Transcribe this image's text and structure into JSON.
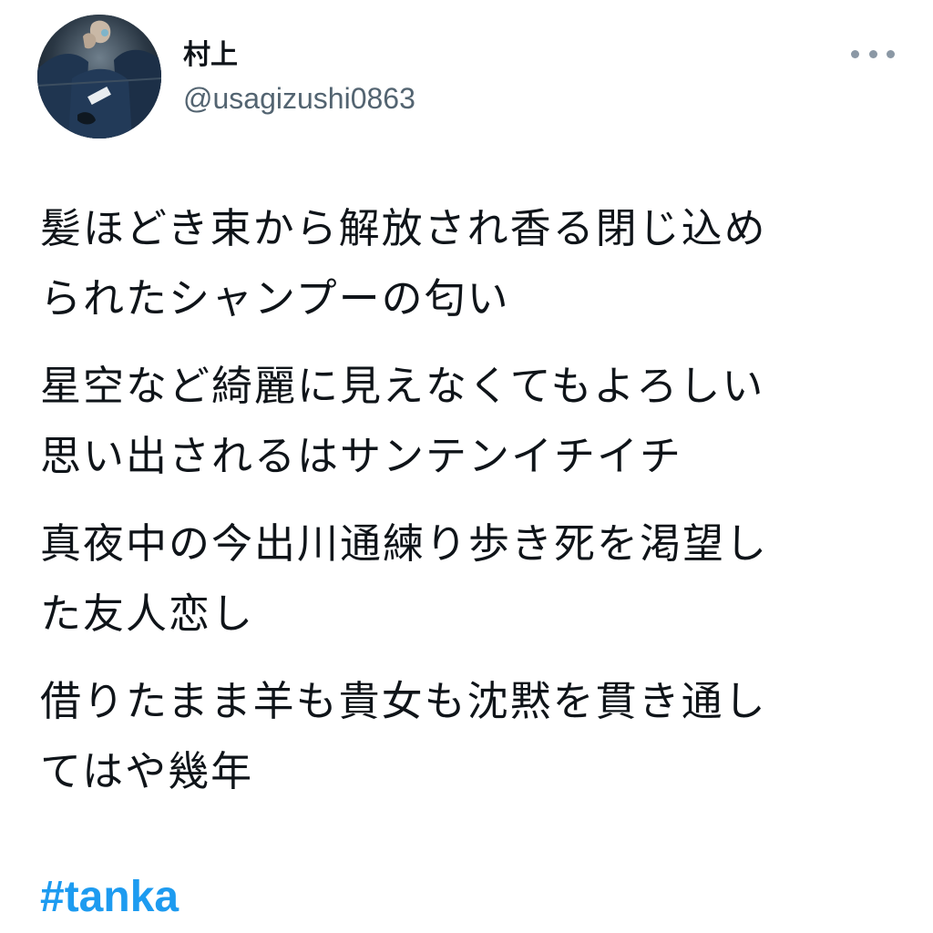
{
  "author": {
    "display_name": "村上",
    "handle": "@usagizushi0863",
    "avatar_icon": "profile-photo"
  },
  "menu": {
    "icon": "more-horizontal-icon"
  },
  "tweet": {
    "stanzas": [
      {
        "lines": [
          "髪ほどき束から解放され香る閉じ込め",
          "られたシャンプーの匂い"
        ]
      },
      {
        "lines": [
          "星空など綺麗に見えなくてもよろしい",
          "思い出されるはサンテンイチイチ"
        ]
      },
      {
        "lines": [
          "真夜中の今出川通練り歩き死を渇望し",
          "た友人恋し"
        ]
      },
      {
        "lines": [
          "借りたまま羊も貴女も沈黙を貫き通し",
          "てはや幾年"
        ]
      }
    ],
    "hashtag": "#tanka"
  },
  "colors": {
    "text": "#0f1419",
    "secondary": "#536471",
    "link": "#1d9bf0"
  }
}
